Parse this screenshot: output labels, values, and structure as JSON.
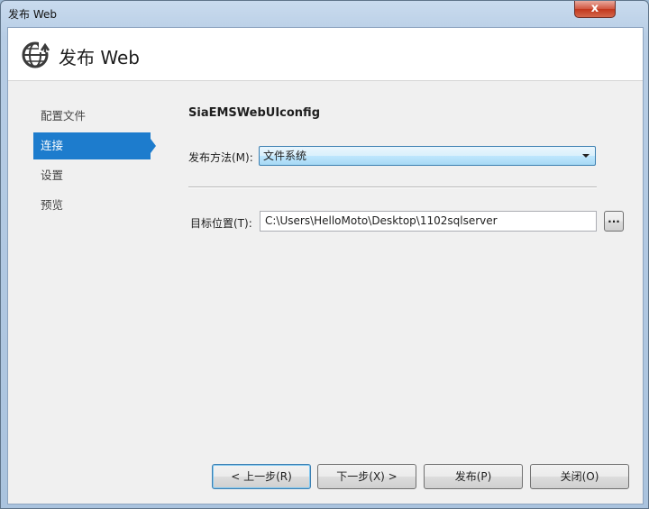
{
  "window": {
    "title": "发布 Web",
    "close_label": "x"
  },
  "header": {
    "icon": "globe-publish-icon",
    "title": "发布 Web"
  },
  "nav": {
    "items": [
      {
        "label": "配置文件",
        "active": false
      },
      {
        "label": "连接",
        "active": true
      },
      {
        "label": "设置",
        "active": false
      },
      {
        "label": "预览",
        "active": false
      }
    ]
  },
  "form": {
    "profile_name": "SiaEMSWebUIconfig",
    "method_label": "发布方法(M):",
    "method_value": "文件系统",
    "target_label": "目标位置(T):",
    "target_value": "C:\\Users\\HelloMoto\\Desktop\\1102sqlserver",
    "browse_label": "..."
  },
  "buttons": {
    "prev": "< 上一步(R)",
    "next": "下一步(X) >",
    "publish": "发布(P)",
    "close": "关闭(O)"
  },
  "colors": {
    "accent": "#1d7ccd",
    "close_button": "#c1371d"
  }
}
